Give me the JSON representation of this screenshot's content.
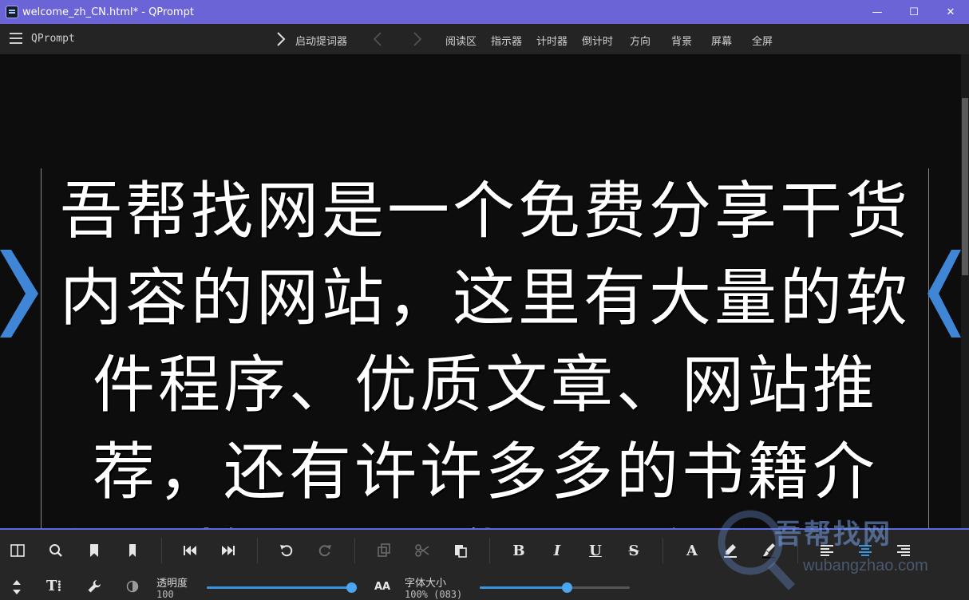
{
  "window": {
    "title": "welcome_zh_CN.html* - QPrompt",
    "minimize_glyph": "—",
    "maximize_glyph": "☐",
    "close_glyph": "✕"
  },
  "menubar": {
    "app_name": "QPrompt",
    "start_label": "启动提词器",
    "items": [
      "阅读区",
      "指示器",
      "计时器",
      "倒计时",
      "方向",
      "背景",
      "屏幕",
      "全屏"
    ]
  },
  "prompter": {
    "lines": [
      "吾帮找网是一个免费分享干货",
      "内容的网站，这里有大量的软",
      "件程序、优质文章、网站推",
      "荐，还有许许多多的书籍介",
      "绍，教程、干货，只有你想不"
    ],
    "text_color": "#ffffff",
    "background_color": "#0d0d0d",
    "marker_color": "#3f86d6"
  },
  "toolbar": {
    "icons": [
      "split-view-icon",
      "search-icon",
      "bookmark-icon",
      "bookmark-filled-icon",
      "skip-back-icon",
      "skip-forward-icon",
      "undo-icon",
      "redo-icon",
      "copy-icon",
      "cut-icon",
      "paste-icon",
      "bold-icon",
      "italic-icon",
      "underline-icon",
      "strikethrough-icon",
      "font-color-icon",
      "highlight-icon",
      "brush-icon",
      "align-left-icon",
      "align-center-icon",
      "align-right-icon"
    ],
    "bold_glyph": "B",
    "italic_glyph": "I",
    "underline_glyph": "U",
    "strike_glyph": "S",
    "font_glyph": "A",
    "text_glyph": "T⁞",
    "accent_color": "#3a95e0"
  },
  "controls": {
    "opacity_label": "透明度",
    "opacity_value": "100",
    "opacity_fraction": 1.0,
    "font_size_icon_text": "AA",
    "font_size_label": "字体大小",
    "font_size_value": "100% (083)",
    "font_size_fraction": 0.59
  },
  "watermark": {
    "text": "吾帮找网",
    "url": "wubangzhao.com"
  }
}
